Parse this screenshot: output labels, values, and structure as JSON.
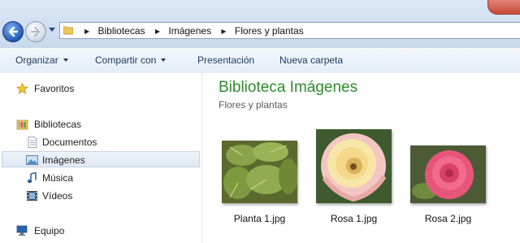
{
  "breadcrumb": {
    "items": [
      "Bibliotecas",
      "Imágenes",
      "Flores y plantas"
    ]
  },
  "toolbar": {
    "organizar": "Organizar",
    "compartir": "Compartir con",
    "presentacion": "Presentación",
    "nueva_carpeta": "Nueva carpeta"
  },
  "sidebar": {
    "favoritos": "Favoritos",
    "bibliotecas": "Bibliotecas",
    "documentos": "Documentos",
    "imagenes": "Imágenes",
    "musica": "Música",
    "videos": "Vídeos",
    "equipo": "Equipo"
  },
  "main": {
    "title": "Biblioteca Imágenes",
    "subtitle": "Flores y plantas",
    "files": [
      "Planta 1.jpg",
      "Rosa 1.jpg",
      "Rosa 2.jpg"
    ]
  },
  "icons": [
    "back-arrow-icon",
    "forward-arrow-icon",
    "folder-icon",
    "star-icon",
    "library-icon",
    "document-icon",
    "picture-icon",
    "music-note-icon",
    "film-icon",
    "computer-icon"
  ],
  "colors": {
    "title_green": "#2e8b2e",
    "accent_blue": "#2259b8"
  }
}
